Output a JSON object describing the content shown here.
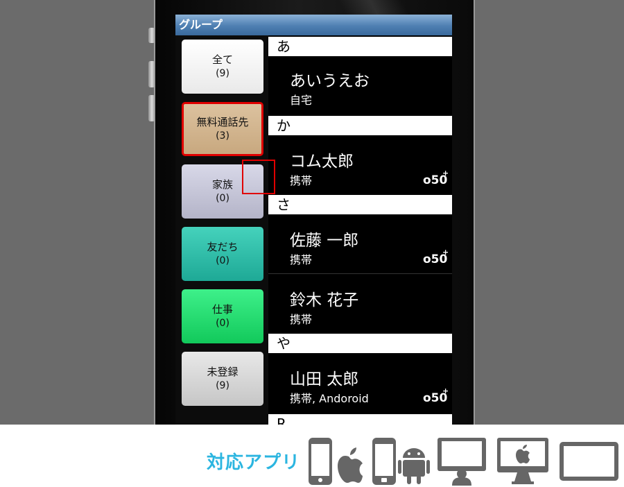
{
  "app": {
    "title": "グループ",
    "accent_color": "#4e7fb2"
  },
  "groups": [
    {
      "label": "全て",
      "count": "(9)",
      "color": "#ffffff"
    },
    {
      "label": "無料通話先",
      "count": "(3)",
      "color": "#d3b38c",
      "selected": true
    },
    {
      "label": "家族",
      "count": "(0)",
      "color": "#c8c8da"
    },
    {
      "label": "友だち",
      "count": "(0)",
      "color": "#2fc2ad"
    },
    {
      "label": "仕事",
      "count": "(0)",
      "color": "#1de06f"
    },
    {
      "label": "未登録",
      "count": "(9)",
      "color": "#d9d9d9"
    }
  ],
  "contacts": {
    "sections": [
      {
        "header": "あ"
      },
      {
        "header": "か"
      },
      {
        "header": "さ"
      },
      {
        "header": "や"
      },
      {
        "header": "R"
      }
    ],
    "items": [
      {
        "name": "あいうえお",
        "type": "自宅",
        "badge": ""
      },
      {
        "name": "コム太郎",
        "type": "携帯",
        "badge": "050-icon"
      },
      {
        "name": "佐藤 一郎",
        "type": "携帯",
        "badge": "050-icon"
      },
      {
        "name": "鈴木 花子",
        "type": "携帯",
        "badge": ""
      },
      {
        "name": "山田 太郎",
        "type": "携帯, Andoroid",
        "badge": "050-icon"
      }
    ],
    "highlight_color": "#e00000"
  },
  "footer": {
    "label": "対応アプリ",
    "label_color": "#2bb5e0",
    "apps": [
      "iphone-apple-icon",
      "android-phone-icon",
      "pc-user-icon",
      "mac-apple-icon",
      "tablet-icon"
    ]
  }
}
